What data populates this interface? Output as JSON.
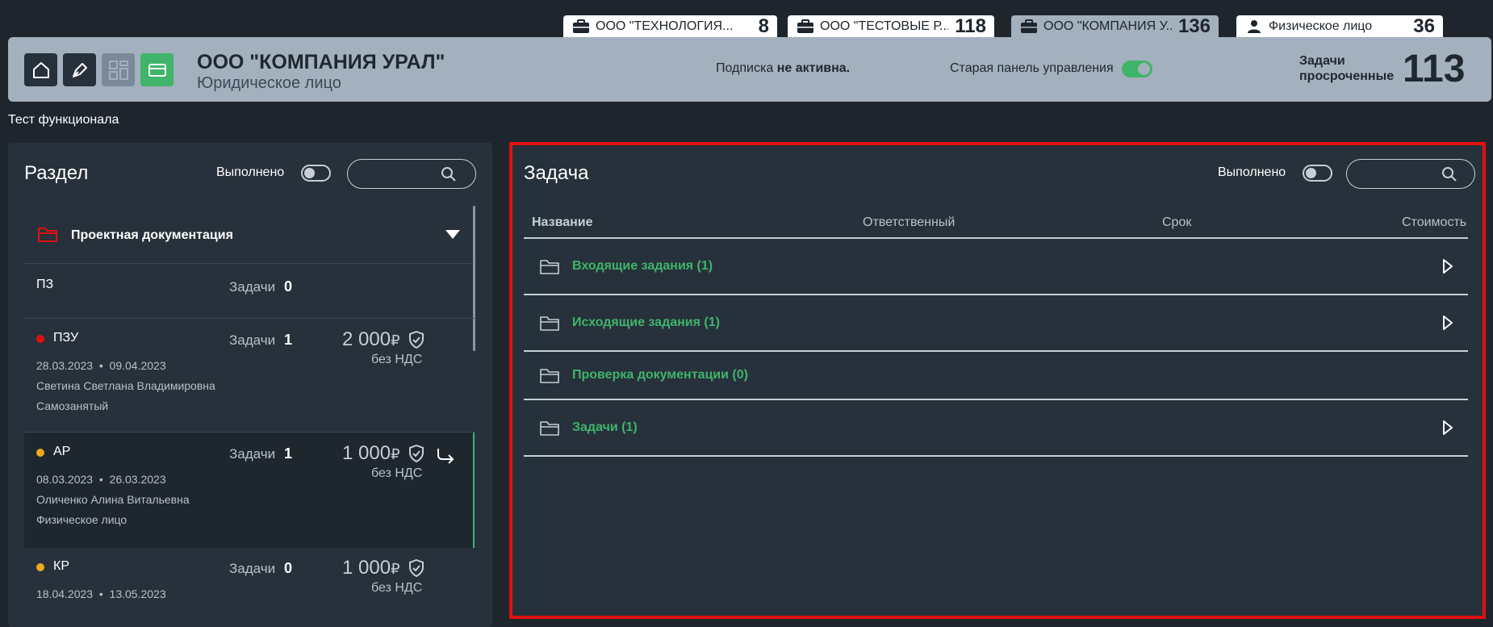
{
  "company_tabs": [
    {
      "name": "ООО \"ТЕХНОЛОГИЯ...",
      "count": "8",
      "icon": "briefcase-icon"
    },
    {
      "name": "ООО \"ТЕСТОВЫЕ Р...",
      "count": "118",
      "icon": "briefcase-icon"
    },
    {
      "name": "ООО \"КОМПАНИЯ У...",
      "count": "136",
      "icon": "briefcase-icon",
      "active": true
    },
    {
      "name": "Физическое лицо",
      "count": "36",
      "icon": "person-icon"
    }
  ],
  "header": {
    "company_name": "ООО \"КОМПАНИЯ УРАЛ\"",
    "company_type": "Юридическое лицо",
    "subscription_label": "Подписка ",
    "subscription_status": "не активна.",
    "old_panel_label": "Старая панель управления",
    "overdue_label_1": "Задачи",
    "overdue_label_2": "просроченные",
    "overdue_count": "113",
    "accent_color": "#3fb46a"
  },
  "subtitle": "Тест функционала",
  "left_panel": {
    "title": "Раздел",
    "done_label": "Выполнено",
    "search_placeholder": "",
    "section_name": "Проектная документация",
    "items": [
      {
        "name": "ПЗ",
        "tasks_label": "Задачи",
        "tasks_count": "0"
      },
      {
        "name": "ПЗУ",
        "status_color": "#e01010",
        "tasks_label": "Задачи",
        "tasks_count": "1",
        "price": "2 000",
        "currency": "₽",
        "vat": "без НДС",
        "date_start": "28.03.2023",
        "date_sep": "•",
        "date_end": "09.04.2023",
        "person": "Светина Светлана Владимировна",
        "person_type": "Самозанятый"
      },
      {
        "name": "АР",
        "status_color": "#f0a818",
        "tasks_label": "Задачи",
        "tasks_count": "1",
        "price": "1 000",
        "currency": "₽",
        "vat": "без НДС",
        "date_start": "08.03.2023",
        "date_sep": "•",
        "date_end": "26.03.2023",
        "person": "Оличенко Алина Витальевна",
        "person_type": "Физическое лицо"
      },
      {
        "name": "КР",
        "status_color": "#f0a818",
        "tasks_label": "Задачи",
        "tasks_count": "0",
        "price": "1 000",
        "currency": "₽",
        "vat": "без НДС",
        "date_start": "18.04.2023",
        "date_sep": "•",
        "date_end": "13.05.2023"
      }
    ]
  },
  "right_panel": {
    "title": "Задача",
    "done_label": "Выполнено",
    "search_placeholder": "",
    "columns": {
      "name": "Название",
      "responsible": "Ответственный",
      "deadline": "Срок",
      "cost": "Стоимость"
    },
    "rows": [
      {
        "name": "Входящие задания (1)",
        "expandable": true
      },
      {
        "name": "Исходящие задания (1)",
        "expandable": true
      },
      {
        "name": "Проверка документации (0)",
        "expandable": false
      },
      {
        "name": "Задачи (1)",
        "expandable": true
      }
    ]
  }
}
